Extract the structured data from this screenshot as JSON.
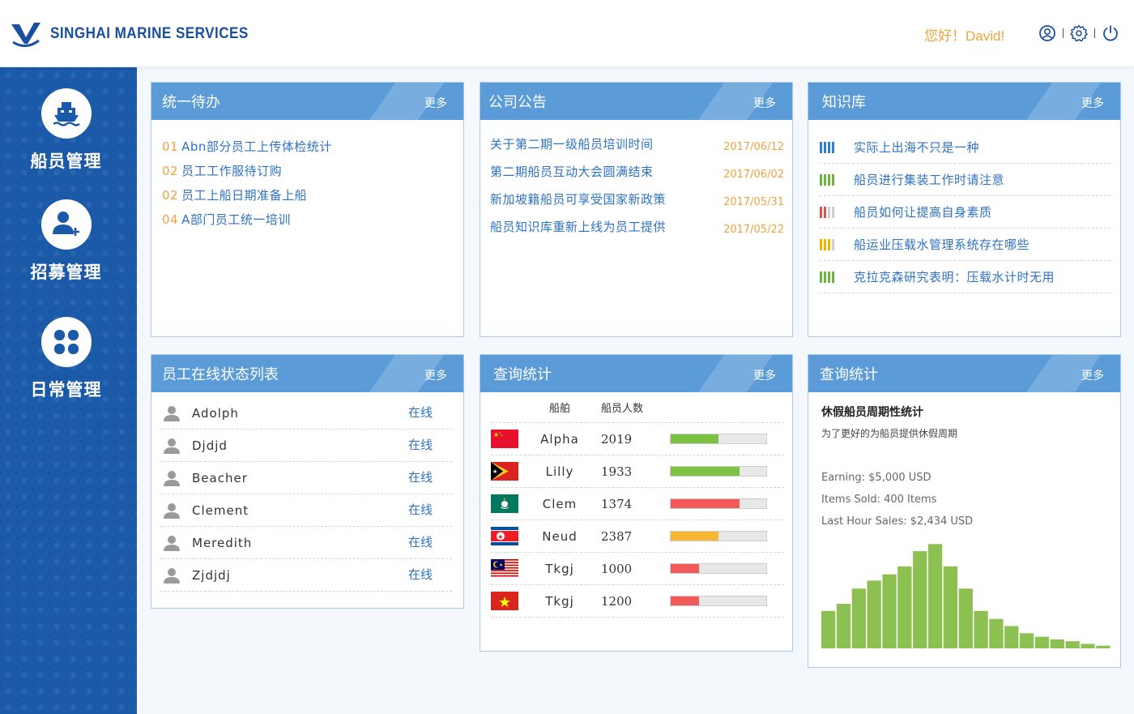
{
  "header": {
    "brand": "SINGHAI MARINE SERVICES",
    "greeting": "您好！David!",
    "icons": [
      "user-icon",
      "gear-icon",
      "power-icon"
    ]
  },
  "sidebar": {
    "items": [
      {
        "label": "船员管理",
        "icon": "ship-icon"
      },
      {
        "label": "招募管理",
        "icon": "add-user-icon"
      },
      {
        "label": "日常管理",
        "icon": "clover-icon"
      }
    ]
  },
  "todo": {
    "title": "统一待办",
    "more": "更多",
    "items": [
      {
        "num": "01",
        "text": "Abn部分员工上传体检统计"
      },
      {
        "num": "02",
        "text": "员工工作服待订购"
      },
      {
        "num": "02",
        "text": "员工上船日期准备上船"
      },
      {
        "num": "04",
        "text": "A部门员工统一培训"
      }
    ]
  },
  "notice": {
    "title": "公司公告",
    "more": "更多",
    "items": [
      {
        "text": "关于第二期一级船员培训时间",
        "date": "2017/06/12"
      },
      {
        "text": "第二期船员互动大会圆满结束",
        "date": "2017/06/02"
      },
      {
        "text": "新加坡籍船员可享受国家新政策",
        "date": "2017/05/31"
      },
      {
        "text": "船员知识库重新上线为员工提供",
        "date": "2017/05/22"
      }
    ]
  },
  "knowledge": {
    "title": "知识库",
    "more": "更多",
    "items": [
      {
        "text": "实际上出海不只是一种",
        "color": "#2d7fd6"
      },
      {
        "text": "船员进行集装工作时请注意",
        "color": "#6cb33f"
      },
      {
        "text": "船员如何让提高自身素质",
        "color": "#d9534f"
      },
      {
        "text": "船运业压载水管理系统存在哪些",
        "color": "#f0b400"
      },
      {
        "text": "克拉克森研究表明：压载水计时无用",
        "color": "#6cb33f"
      }
    ]
  },
  "staff": {
    "title": "员工在线状态列表",
    "more": "更多",
    "items": [
      {
        "name": "Adolph",
        "status": "在线"
      },
      {
        "name": "Djdjd",
        "status": "在线"
      },
      {
        "name": "Beacher",
        "status": "在线"
      },
      {
        "name": "Clement",
        "status": "在线"
      },
      {
        "name": "Meredith",
        "status": "在线"
      },
      {
        "name": "Zjdjdj",
        "status": "在线"
      }
    ]
  },
  "query": {
    "title": "查询统计",
    "more": "更多",
    "col_ship": "船舶",
    "col_count": "船员人数",
    "rows": [
      {
        "flag": "china-flag",
        "ship": "Alpha",
        "count": "2019",
        "level": 0.5,
        "color": "#7cc242"
      },
      {
        "flag": "east-timor-flag",
        "ship": "Lilly",
        "count": "1933",
        "level": 0.72,
        "color": "#7cc242"
      },
      {
        "flag": "macau-flag",
        "ship": "Clem",
        "count": "1374",
        "level": 0.72,
        "color": "#f25a5a"
      },
      {
        "flag": "north-korea-flag",
        "ship": "Neud",
        "count": "2387",
        "level": 0.5,
        "color": "#f7b733"
      },
      {
        "flag": "malaysia-flag",
        "ship": "Tkgj",
        "count": "1000",
        "level": 0.3,
        "color": "#f25a5a"
      },
      {
        "flag": "vietnam-flag",
        "ship": "Tkgj",
        "count": "1200",
        "level": 0.3,
        "color": "#f25a5a"
      }
    ]
  },
  "stats": {
    "title": "查询统计",
    "more": "更多",
    "heading": "休假船员周期性统计",
    "subheading": "为了更好的为船员提供休假周期",
    "lines": [
      "Earning: $5,000 USD",
      "Items Sold: 400 Items",
      "Last Hour Sales: $2,434 USD"
    ]
  },
  "chart_data": {
    "type": "bar",
    "values": [
      42,
      50,
      67,
      76,
      83,
      92,
      109,
      117,
      92,
      67,
      42,
      33,
      25,
      17,
      13,
      10,
      8,
      5,
      3
    ],
    "color": "#8cc152"
  }
}
